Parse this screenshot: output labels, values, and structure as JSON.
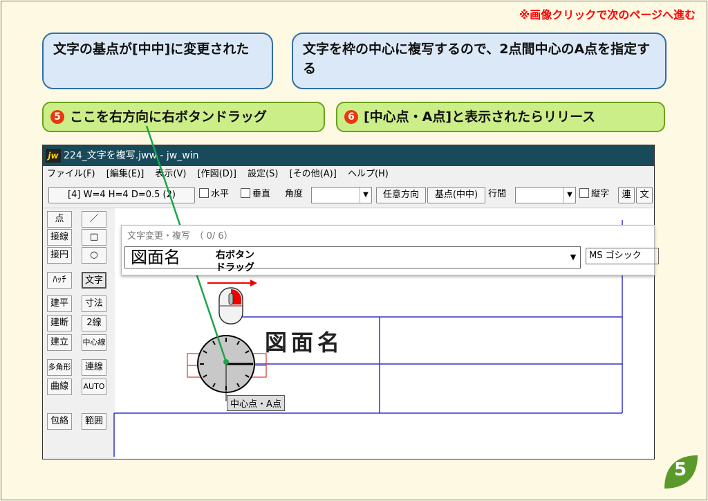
{
  "top_note": "※画像クリックで次のページへ進む",
  "bubbles": {
    "left": "文字の基点が[中中]に変更された",
    "right": "文字を枠の中心に複写するので、2点間中心のA点を指定する"
  },
  "steps": [
    {
      "num": "5",
      "text": "ここを右方向に右ボタンドラッグ"
    },
    {
      "num": "6",
      "text": "[中心点・A点]と表示されたらリリース"
    }
  ],
  "window": {
    "title": "224_文字を複写.jww - jw_win",
    "menu": [
      "ファイル(F)",
      "[編集(E)]",
      "表示(V)",
      "[作図(D)]",
      "設定(S)",
      "[その他(A)]",
      "ヘルプ(H)"
    ],
    "toolbar": {
      "size_button": "[4]  W=4  H=4  D=0.5 (2)",
      "horizontal": "水平",
      "vertical": "垂直",
      "angle_label": "角度",
      "any_direction": "任意方向",
      "base_point": "基点(中中)",
      "line_spacing": "行間",
      "vertical_text": "縦字",
      "continuous": "連",
      "text_btn": "文"
    },
    "side_left": [
      "点",
      "接線",
      "接円",
      "ﾊｯﾁ",
      "建平",
      "建断",
      "建立",
      "多角形",
      "曲線",
      "包絡"
    ],
    "side_right": [
      "／",
      "□",
      "○",
      "文字",
      "寸法",
      "2線",
      "中心線",
      "連線",
      "AUTO",
      "範囲"
    ],
    "dialog": {
      "title": "文字変更・複写　（ 0/ 6）",
      "input_value": "図面名",
      "font": "MS ゴシック"
    },
    "figure_text": "図面名",
    "cursor_readout": "中心点・A点"
  },
  "annotation": {
    "drag_label_1": "右ボタン",
    "drag_label_2": "ドラッグ"
  },
  "page_number": "5",
  "colors": {
    "background": "#fdf9e3",
    "bubble_fill": "#dbe8f7",
    "bubble_border": "#2f6fa8",
    "step_fill": "#ccee88",
    "step_border": "#6aa21c",
    "accent_red": "#e8380d",
    "titlebar": "#184a5a",
    "drawing_lines": "#3333cc",
    "leaf_green": "#5a9a2a"
  }
}
